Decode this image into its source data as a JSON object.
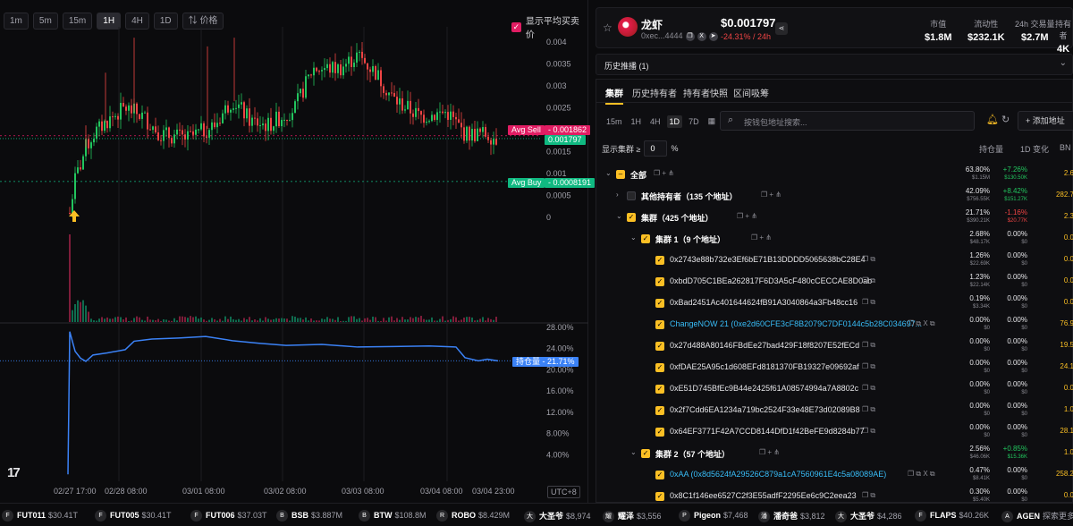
{
  "timeframes": [
    "1m",
    "5m",
    "15m",
    "1H",
    "4H",
    "1D"
  ],
  "active_timeframe": "1H",
  "indicator_label": "价格",
  "avg_toggle_label": "显示平均买卖价",
  "price_axis": [
    "0.004",
    "0.0035",
    "0.003",
    "0.0025",
    "0.002",
    "0.0015",
    "0.001",
    "0.0005",
    "0"
  ],
  "tags": {
    "avg_sell_label": "Avg Sell",
    "avg_sell_value": "0.001862",
    "current_price": "0.001797",
    "avg_buy_label": "Avg Buy",
    "avg_buy_value": "0.0008191",
    "holding_label": "持仓量",
    "holding_value": "21.71%"
  },
  "holding_axis": [
    "28.00%",
    "24.00%",
    "20.00%",
    "16.00%",
    "12.00%",
    "8.00%",
    "4.00%"
  ],
  "time_labels": [
    "02/27 17:00",
    "02/28 08:00",
    "03/01 08:00",
    "03/02 08:00",
    "03/03 08:00",
    "03/04 08:00",
    "03/04 23:00"
  ],
  "timezone": "UTC+8",
  "token": {
    "name": "龙虾",
    "address": "0xec...4444",
    "price": "$0.001797",
    "change": "-24.31% / 24h",
    "stats": [
      {
        "label": "市值",
        "value": "$1.8M"
      },
      {
        "label": "流动性",
        "value": "$232.1K"
      },
      {
        "label": "24h 交易量",
        "value": "$2.7M"
      },
      {
        "label": "持有者",
        "value": "4K"
      }
    ]
  },
  "history_label": "历史推播 (1)",
  "tabs": [
    "集群",
    "历史持有者",
    "持有者快照",
    "区间吸筹"
  ],
  "panel_timeframes": [
    "15m",
    "1H",
    "4H",
    "1D",
    "7D"
  ],
  "panel_active_timeframe": "1D",
  "search_placeholder": "按钱包地址搜索...",
  "add_address_label": "+ 添加地址",
  "filter_label": "显示集群 ≥",
  "filter_value": "0",
  "filter_unit": "%",
  "columns": [
    "持仓量",
    "1D 变化",
    "BN"
  ],
  "rows": [
    {
      "level": 0,
      "chevron": "⌄",
      "cb": "partial",
      "label": "全部",
      "bold": true,
      "cyan": false,
      "hold": "63.80%",
      "hold_usd": "$1.15M",
      "chg": "+7.26%",
      "chg_usd": "$130.50K",
      "dir": "pos",
      "bn": "2.6"
    },
    {
      "level": 1,
      "chevron": "›",
      "cb": "off",
      "label": "其他持有者（135 个地址）",
      "bold": true,
      "cyan": false,
      "hold": "42.09%",
      "hold_usd": "$756.55K",
      "chg": "+8.42%",
      "chg_usd": "$151.27K",
      "dir": "pos",
      "bn": "282.7"
    },
    {
      "level": 1,
      "chevron": "⌄",
      "cb": "on",
      "label": "集群（425 个地址）",
      "bold": true,
      "cyan": false,
      "hold": "21.71%",
      "hold_usd": "$390.21K",
      "chg": "-1.16%",
      "chg_usd": "$20.77K",
      "dir": "neg",
      "bn": "2.3"
    },
    {
      "level": 2,
      "chevron": "⌄",
      "cb": "on",
      "label": "集群 1（9 个地址）",
      "bold": true,
      "cyan": false,
      "hold": "2.68%",
      "hold_usd": "$48.17K",
      "chg": "0.00%",
      "chg_usd": "$0",
      "dir": "zero",
      "bn": "0.0"
    },
    {
      "level": 3,
      "chevron": "",
      "cb": "on",
      "label": "0x2743e88b732e3Ef6bE71B13DDDD5065638bC28E4",
      "bold": false,
      "cyan": false,
      "hold": "1.26%",
      "hold_usd": "$22.69K",
      "chg": "0.00%",
      "chg_usd": "$0",
      "dir": "zero",
      "bn": "0.0"
    },
    {
      "level": 3,
      "chevron": "",
      "cb": "on",
      "label": "0xbdD705C1BEa262817F6D3A5cF480cCECCAE8D0ab",
      "bold": false,
      "cyan": false,
      "hold": "1.23%",
      "hold_usd": "$22.14K",
      "chg": "0.00%",
      "chg_usd": "$0",
      "dir": "zero",
      "bn": "0.0"
    },
    {
      "level": 3,
      "chevron": "",
      "cb": "on",
      "label": "0xBad2451Ac401644624fB91A3040864a3Fb48cc16",
      "bold": false,
      "cyan": false,
      "hold": "0.19%",
      "hold_usd": "$3.34K",
      "chg": "0.00%",
      "chg_usd": "$0",
      "dir": "zero",
      "bn": "0.0"
    },
    {
      "level": 3,
      "chevron": "",
      "cb": "on",
      "label": "ChangeNOW 21 (0xe2d60CFE3cF8B2079C7DF0144c5b28C034697...",
      "bold": false,
      "cyan": true,
      "hold": "0.00%",
      "hold_usd": "$0",
      "chg": "0.00%",
      "chg_usd": "$0",
      "dir": "zero",
      "bn": "76.9"
    },
    {
      "level": 3,
      "chevron": "",
      "cb": "on",
      "label": "0x27d488A80146FBdEe27bad429F18f8207E52fECd",
      "bold": false,
      "cyan": false,
      "hold": "0.00%",
      "hold_usd": "$0",
      "chg": "0.00%",
      "chg_usd": "$0",
      "dir": "zero",
      "bn": "19.5"
    },
    {
      "level": 3,
      "chevron": "",
      "cb": "on",
      "label": "0xfDAE25A95c1d608EFd8181370FB19327e09692af",
      "bold": false,
      "cyan": false,
      "hold": "0.00%",
      "hold_usd": "$0",
      "chg": "0.00%",
      "chg_usd": "$0",
      "dir": "zero",
      "bn": "24.1"
    },
    {
      "level": 3,
      "chevron": "",
      "cb": "on",
      "label": "0xE51D745BfEc9B44e2425f61A08574994a7A8802c",
      "bold": false,
      "cyan": false,
      "hold": "0.00%",
      "hold_usd": "$0",
      "chg": "0.00%",
      "chg_usd": "$0",
      "dir": "zero",
      "bn": "0.0"
    },
    {
      "level": 3,
      "chevron": "",
      "cb": "on",
      "label": "0x2f7Cdd6EA1234a719bc2524F33e48E73d02089B8",
      "bold": false,
      "cyan": false,
      "hold": "0.00%",
      "hold_usd": "$0",
      "chg": "0.00%",
      "chg_usd": "$0",
      "dir": "zero",
      "bn": "1.0"
    },
    {
      "level": 3,
      "chevron": "",
      "cb": "on",
      "label": "0x64EF3771F42A7CCD8144DfD1f42BeFE9d8284b77",
      "bold": false,
      "cyan": false,
      "hold": "0.00%",
      "hold_usd": "$0",
      "chg": "0.00%",
      "chg_usd": "$0",
      "dir": "zero",
      "bn": "28.1"
    },
    {
      "level": 2,
      "chevron": "⌄",
      "cb": "on",
      "label": "集群 2（57 个地址）",
      "bold": true,
      "cyan": false,
      "hold": "2.56%",
      "hold_usd": "$46.06K",
      "chg": "+0.85%",
      "chg_usd": "$15.36K",
      "dir": "pos",
      "bn": "1.0"
    },
    {
      "level": 3,
      "chevron": "",
      "cb": "on",
      "label": "0xAA (0x8d5624fA29526C879a1cA7560961E4c5a08089AE)",
      "bold": false,
      "cyan": true,
      "hold": "0.47%",
      "hold_usd": "$8.41K",
      "chg": "0.00%",
      "chg_usd": "$0",
      "dir": "zero",
      "bn": "258.2"
    },
    {
      "level": 3,
      "chevron": "",
      "cb": "on",
      "label": "0x8C1f146ee6527C2f3E55adfF2295Ee6c9C2eea23",
      "bold": false,
      "cyan": false,
      "hold": "0.30%",
      "hold_usd": "$5.40K",
      "chg": "0.00%",
      "chg_usd": "$0",
      "dir": "zero",
      "bn": "0.0"
    }
  ],
  "ticker": [
    {
      "icon": "F",
      "name": "FUT011",
      "price": "$30.41T"
    },
    {
      "icon": "F",
      "name": "FUT005",
      "price": "$30.41T"
    },
    {
      "icon": "F",
      "name": "FUT006",
      "price": "$37.03T"
    },
    {
      "icon": "B",
      "name": "BSB",
      "price": "$3.887M"
    },
    {
      "icon": "B",
      "name": "BTW",
      "price": "$108.8M"
    },
    {
      "icon": "R",
      "name": "ROBO",
      "price": "$8.429M"
    },
    {
      "icon": "大",
      "name": "大圣爷",
      "price": "$8,974"
    },
    {
      "icon": "耀",
      "name": "耀泽",
      "price": "$3,556"
    },
    {
      "icon": "P",
      "name": "Pigeon",
      "price": "$7,468"
    },
    {
      "icon": "潘",
      "name": "潘奇爸",
      "price": "$3,812"
    },
    {
      "icon": "大",
      "name": "大圣爷",
      "price": "$4,286"
    },
    {
      "icon": "F",
      "name": "FLAPS",
      "price": "$40.26K"
    },
    {
      "icon": "A",
      "name": "AGEN",
      "price": "探索更多"
    }
  ],
  "colors": {
    "up": "#22c55e",
    "down": "#ef4444",
    "accent": "#fbbf24",
    "holding_line": "#3b82f6",
    "sell_tag": "#e11d63",
    "price_tag": "#10b981"
  }
}
